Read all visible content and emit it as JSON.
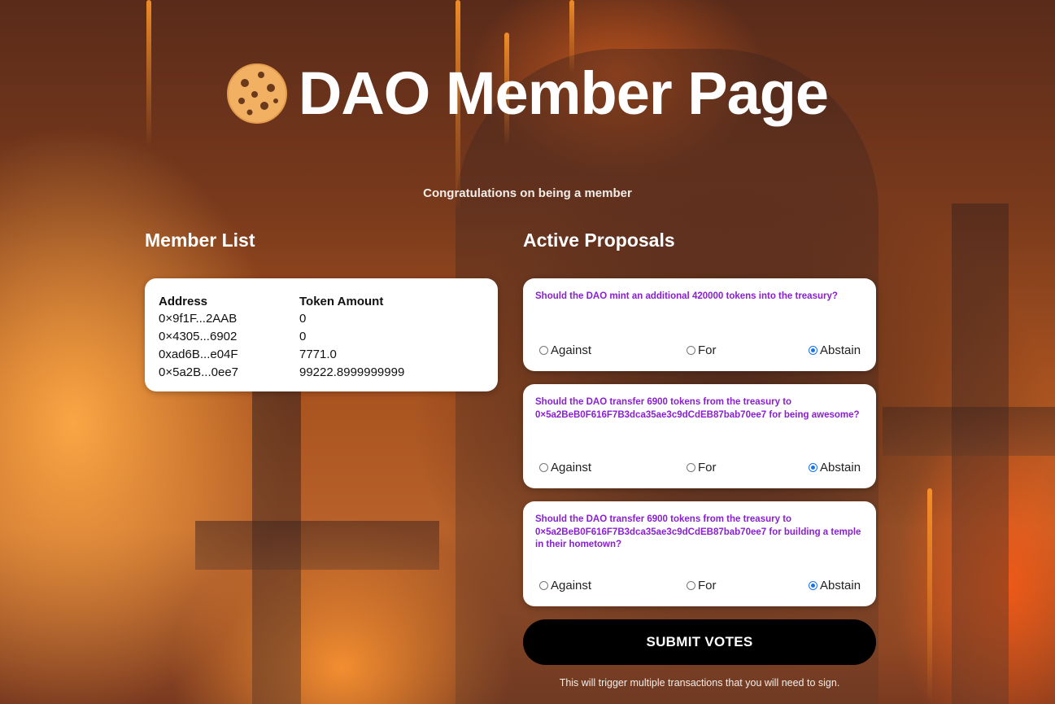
{
  "header": {
    "title": "DAO Member Page",
    "subtitle": "Congratulations on being a member",
    "logo_icon": "cookie-icon"
  },
  "member_list": {
    "title": "Member List",
    "columns": [
      "Address",
      "Token Amount"
    ],
    "rows": [
      {
        "address": "0×9f1F...2AAB",
        "amount": "0"
      },
      {
        "address": "0×4305...6902",
        "amount": "0"
      },
      {
        "address": "0xad6B...e04F",
        "amount": "7771.0"
      },
      {
        "address": "0×5a2B...0ee7",
        "amount": "99222.8999999999"
      }
    ]
  },
  "proposals": {
    "title": "Active Proposals",
    "option_labels": {
      "against": "Against",
      "for": "For",
      "abstain": "Abstain"
    },
    "items": [
      {
        "text": "Should the DAO mint an additional 420000 tokens into the treasury?",
        "selected": "abstain"
      },
      {
        "text": "Should the DAO transfer 6900 tokens from the treasury to 0×5a2BeB0F616F7B3dca35ae3c9dCdEB87bab70ee7 for being awesome?",
        "selected": "abstain"
      },
      {
        "text": "Should the DAO transfer 6900 tokens from the treasury to 0×5a2BeB0F616F7B3dca35ae3c9dCdEB87bab70ee7 for building a temple in their hometown?",
        "selected": "abstain"
      }
    ]
  },
  "submit": {
    "label": "SUBMIT VOTES",
    "note": "This will trigger multiple transactions that you will need to sign."
  },
  "colors": {
    "proposal_text": "#8a1ed1",
    "radio_checked": "#1a73e8",
    "button_bg": "#000000"
  }
}
